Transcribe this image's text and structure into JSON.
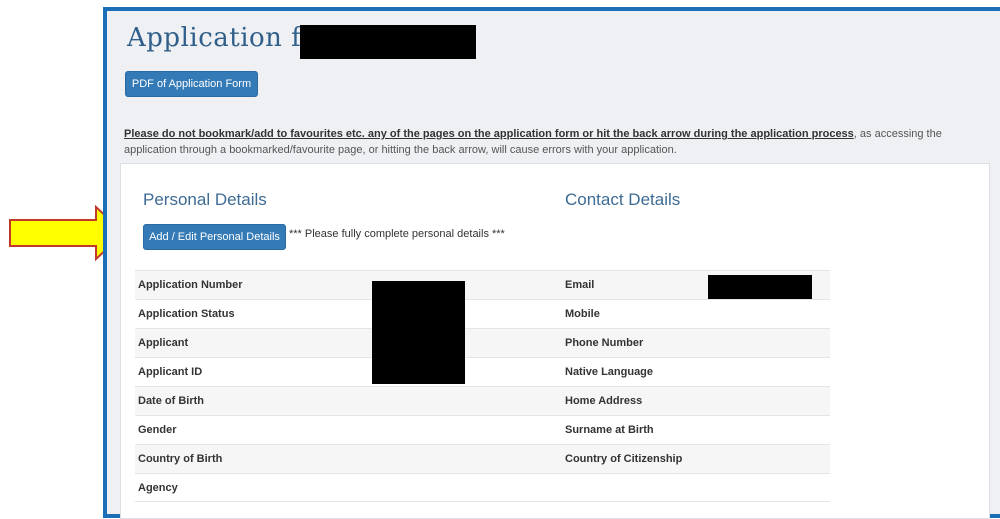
{
  "page": {
    "title": "Application for",
    "pdf_button": "PDF of Application Form",
    "notice_bold": "Please do not bookmark/add to favourites etc. any of the pages on the application form or hit the back arrow during the application process",
    "notice_rest": ", as accessing the application through a bookmarked/favourite page, or hitting the back arrow, will cause errors with your application."
  },
  "personal": {
    "heading": "Personal Details",
    "edit_button": "Add / Edit Personal Details",
    "requirement": "*** Please fully complete personal details ***",
    "fields": [
      "Application Number",
      "Application Status",
      "Applicant",
      "Applicant ID",
      "Date of Birth",
      "Gender",
      "Country of Birth",
      "Agency"
    ]
  },
  "contact": {
    "heading": "Contact Details",
    "fields": [
      "Email",
      "Mobile",
      "Phone Number",
      "Native Language",
      "Home Address",
      "Surname at Birth",
      "Country of Citizenship",
      ""
    ]
  },
  "colors": {
    "frame": "#1b6fb7",
    "button": "#337ab7",
    "arrow_fill": "#ffff00",
    "arrow_stroke": "#c0392b"
  }
}
